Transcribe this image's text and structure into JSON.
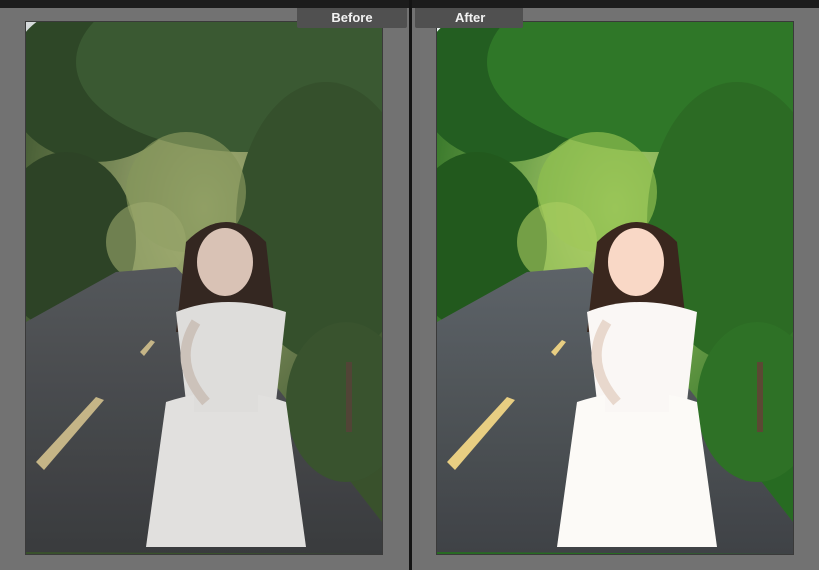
{
  "compare": {
    "before_label": "Before",
    "after_label": "After"
  },
  "photo": {
    "subject": "photo-woman-white-dress-on-tree-lined-road",
    "colors": {
      "pane_bg": "#727272",
      "label_bg": "#505050",
      "road": "#4f5154",
      "foliage": "#3f6d2f",
      "dress": "#f2f0ee"
    }
  }
}
